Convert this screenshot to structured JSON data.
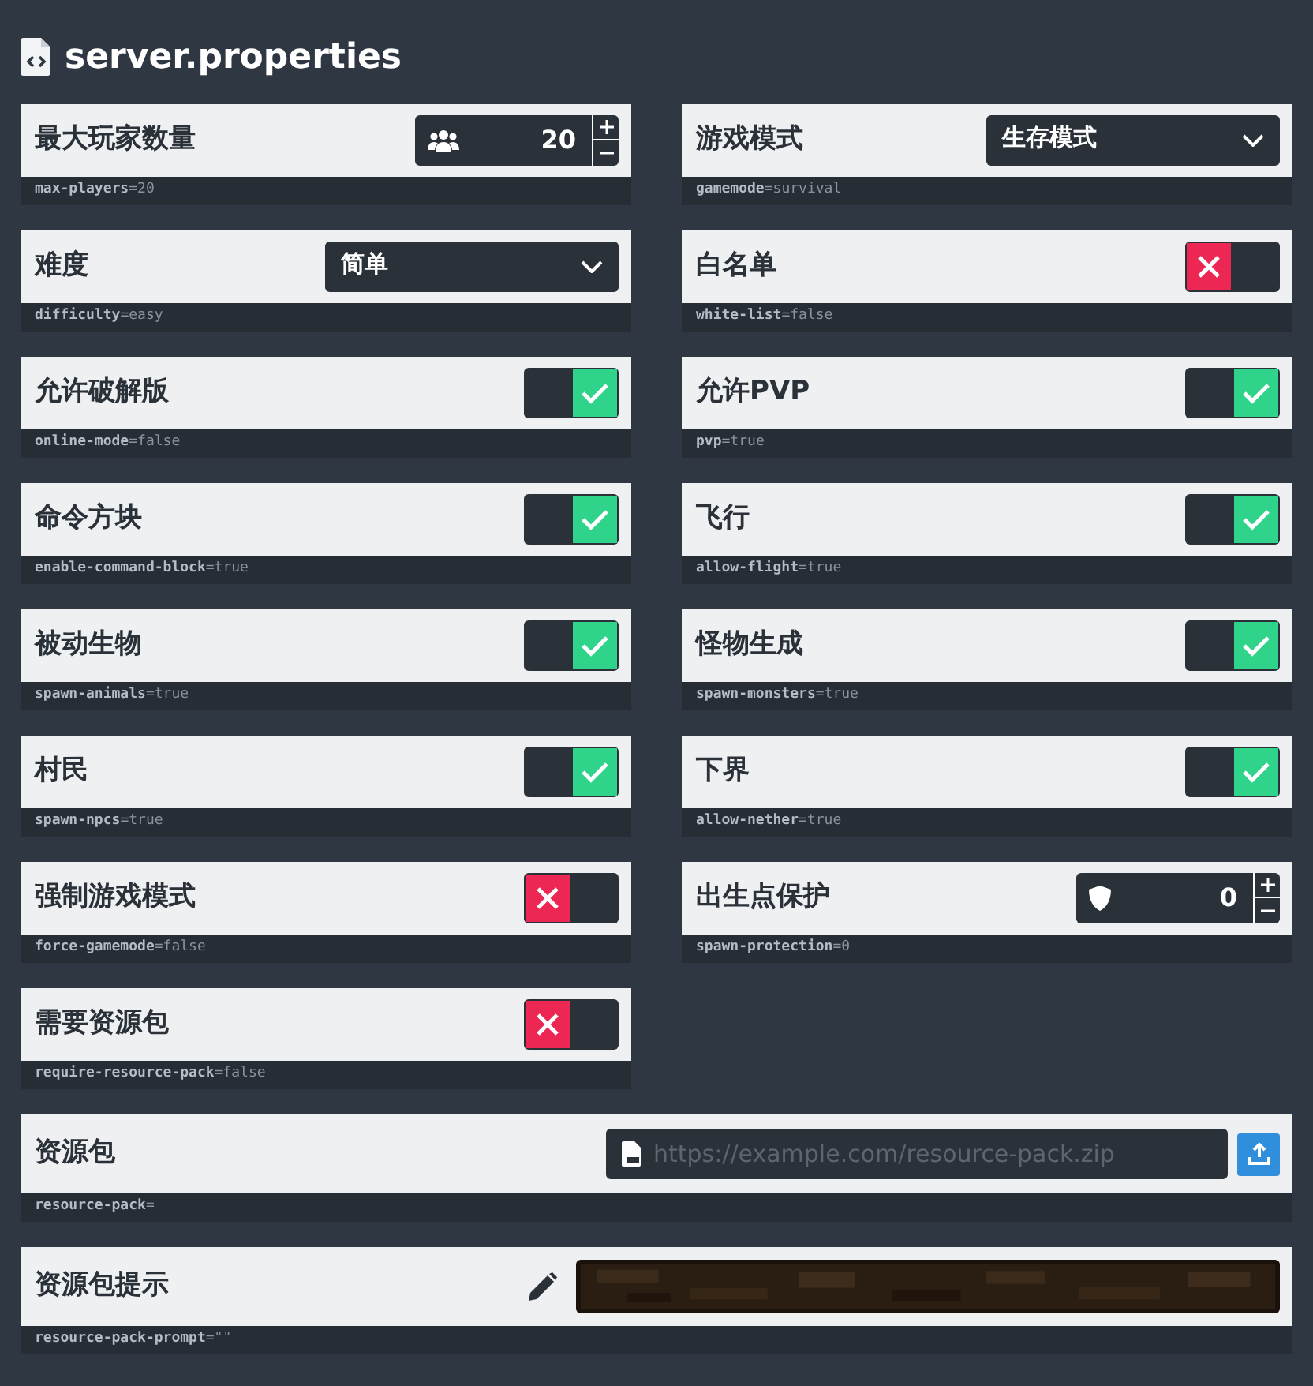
{
  "title": "server.properties",
  "settings": [
    {
      "label": "最大玩家数量",
      "kind": "number",
      "value": "20",
      "key": "max-players",
      "assigned": "=20"
    },
    {
      "label": "游戏模式",
      "kind": "select",
      "value": "生存模式",
      "key": "gamemode",
      "assigned": "=survival"
    },
    {
      "label": "难度",
      "kind": "select",
      "value": "简单",
      "key": "difficulty",
      "assigned": "=easy"
    },
    {
      "label": "白名单",
      "kind": "toggle",
      "on": false,
      "key": "white-list",
      "assigned": "=false"
    },
    {
      "label": "允许破解版",
      "kind": "toggle",
      "on": true,
      "key": "online-mode",
      "assigned": "=false"
    },
    {
      "label": "允许PVP",
      "kind": "toggle",
      "on": true,
      "key": "pvp",
      "assigned": "=true"
    },
    {
      "label": "命令方块",
      "kind": "toggle",
      "on": true,
      "key": "enable-command-block",
      "assigned": "=true"
    },
    {
      "label": "飞行",
      "kind": "toggle",
      "on": true,
      "key": "allow-flight",
      "assigned": "=true"
    },
    {
      "label": "被动生物",
      "kind": "toggle",
      "on": true,
      "key": "spawn-animals",
      "assigned": "=true"
    },
    {
      "label": "怪物生成",
      "kind": "toggle",
      "on": true,
      "key": "spawn-monsters",
      "assigned": "=true"
    },
    {
      "label": "村民",
      "kind": "toggle",
      "on": true,
      "key": "spawn-npcs",
      "assigned": "=true"
    },
    {
      "label": "下界",
      "kind": "toggle",
      "on": true,
      "key": "allow-nether",
      "assigned": "=true"
    },
    {
      "label": "强制游戏模式",
      "kind": "toggle",
      "on": false,
      "key": "force-gamemode",
      "assigned": "=false"
    },
    {
      "label": "出生点保护",
      "kind": "number",
      "value": "0",
      "key": "spawn-protection",
      "assigned": "=0"
    },
    {
      "label": "需要资源包",
      "kind": "toggle",
      "on": false,
      "key": "require-resource-pack",
      "assigned": "=false"
    }
  ],
  "wide_settings": [
    {
      "label": "资源包",
      "kind": "url",
      "placeholder": "https://example.com/resource-pack.zip",
      "key": "resource-pack",
      "assigned": "="
    },
    {
      "label": "资源包提示",
      "kind": "prompt",
      "key": "resource-pack-prompt",
      "assigned": "=\"\""
    }
  ]
}
